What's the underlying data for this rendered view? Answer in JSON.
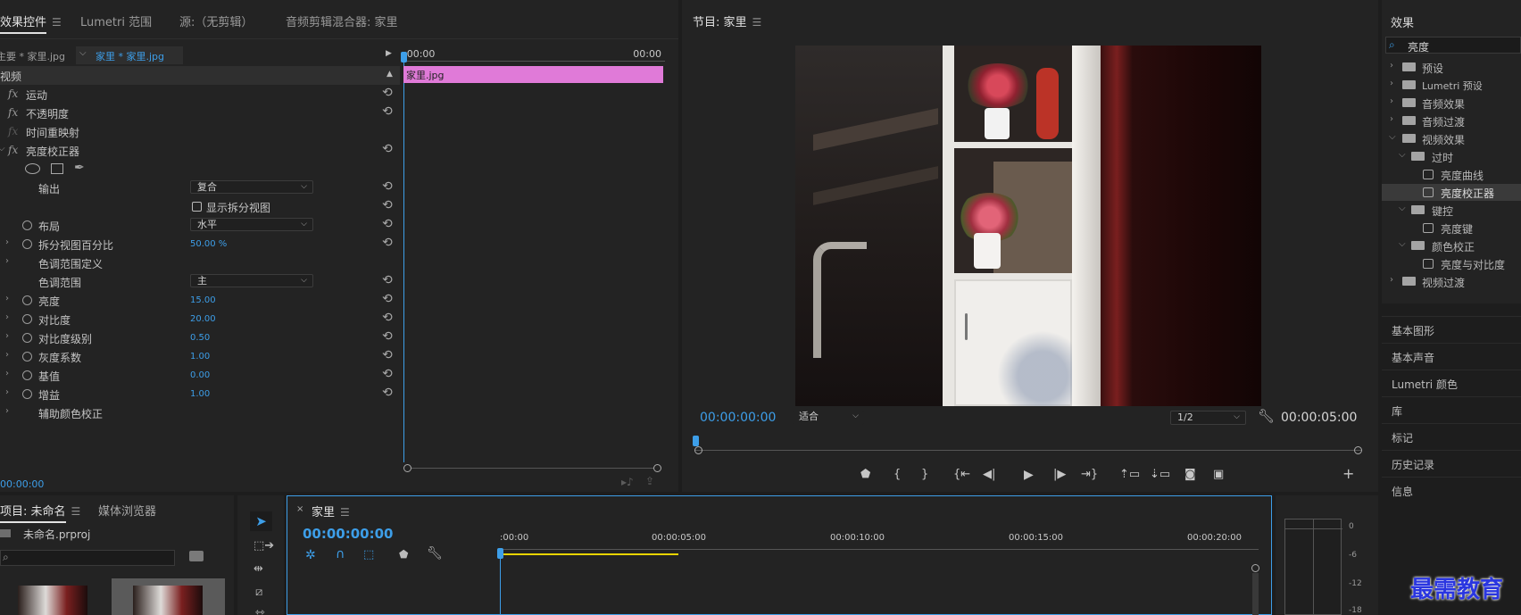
{
  "effect_controls": {
    "tabs": [
      "效果控件",
      "Lumetri 范围",
      "源:（无剪辑）",
      "音频剪辑混合器: 家里"
    ],
    "master_clip": "主要 * 家里.jpg",
    "sequence_clip": "家里 * 家里.jpg",
    "timeline_start": ":00:00",
    "timeline_end": "00:00",
    "clip_label": "家里.jpg",
    "section_video": "视频",
    "effects": [
      "运动",
      "不透明度",
      "时间重映射",
      "亮度校正器"
    ],
    "props": {
      "output_label": "输出",
      "output_value": "复合",
      "split_view_label": "显示拆分视图",
      "layout_label": "布局",
      "layout_value": "水平",
      "split_percent_label": "拆分视图百分比",
      "split_percent_value": "50.00 %",
      "tonal_def_label": "色调范围定义",
      "tonal_range_label": "色调范围",
      "tonal_range_value": "主",
      "brightness_label": "亮度",
      "brightness_value": "15.00",
      "contrast_label": "对比度",
      "contrast_value": "20.00",
      "contrast_level_label": "对比度级别",
      "contrast_level_value": "0.50",
      "gamma_label": "灰度系数",
      "gamma_value": "1.00",
      "pedestal_label": "基值",
      "pedestal_value": "0.00",
      "gain_label": "增益",
      "gain_value": "1.00",
      "secondary_label": "辅助颜色校正"
    },
    "timecode": "00:00:00"
  },
  "program": {
    "title": "节目: 家里",
    "timecode": "00:00:00:00",
    "fit": "适合",
    "resolution": "1/2",
    "duration": "00:00:05:00"
  },
  "effects_panel": {
    "title": "效果",
    "search_value": "亮度",
    "tree": [
      {
        "label": "预设",
        "depth": 0,
        "kind": "folder-closed"
      },
      {
        "label": "Lumetri 预设",
        "depth": 0,
        "kind": "folder-closed"
      },
      {
        "label": "音频效果",
        "depth": 0,
        "kind": "folder-closed"
      },
      {
        "label": "音频过渡",
        "depth": 0,
        "kind": "folder-closed"
      },
      {
        "label": "视频效果",
        "depth": 0,
        "kind": "folder-open"
      },
      {
        "label": "过时",
        "depth": 1,
        "kind": "folder-open"
      },
      {
        "label": "亮度曲线",
        "depth": 2,
        "kind": "effect"
      },
      {
        "label": "亮度校正器",
        "depth": 2,
        "kind": "effect",
        "selected": true
      },
      {
        "label": "键控",
        "depth": 1,
        "kind": "folder-open"
      },
      {
        "label": "亮度键",
        "depth": 2,
        "kind": "effect"
      },
      {
        "label": "颜色校正",
        "depth": 1,
        "kind": "folder-open"
      },
      {
        "label": "亮度与对比度",
        "depth": 2,
        "kind": "effect"
      },
      {
        "label": "视频过渡",
        "depth": 0,
        "kind": "folder-closed"
      }
    ],
    "side_items": [
      "基本图形",
      "基本声音",
      "Lumetri 颜色",
      "库",
      "标记",
      "历史记录",
      "信息"
    ]
  },
  "project": {
    "tabs": [
      "项目: 未命名",
      "媒体浏览器"
    ],
    "file": "未命名.prproj"
  },
  "timeline": {
    "tab": "家里",
    "timecode": "00:00:00:00",
    "ruler": [
      ":00:00",
      "00:00:05:00",
      "00:00:10:00",
      "00:00:15:00",
      "00:00:20:00"
    ]
  },
  "audio_meter": [
    "0",
    "-6",
    "-12",
    "-18"
  ],
  "watermark": "最需教育",
  "colors": {
    "accent": "#3d9ee8",
    "clip_pink": "#e07ad8",
    "work_area": "#e8d400",
    "selected_row": "#3a3a3a"
  }
}
